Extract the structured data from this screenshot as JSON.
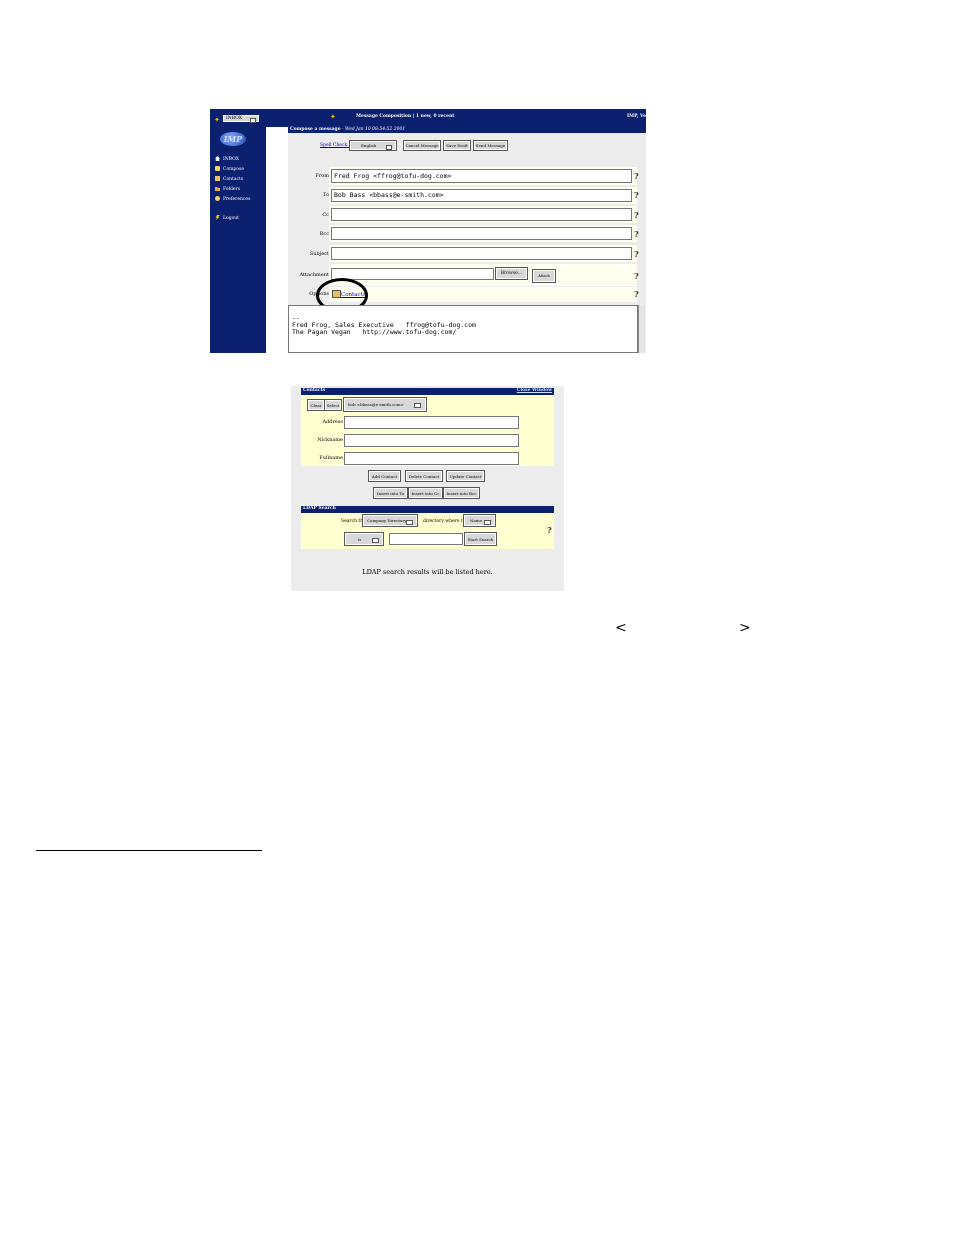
{
  "mail": {
    "topbar": {
      "folder_select": "INBOX",
      "title": "Message Composition | 1 new, 0 recent",
      "right_text": "IMP, Ve"
    },
    "sidebar": {
      "logo_text": "IMP",
      "items": [
        {
          "label": "INBOX",
          "icon": "house-icon"
        },
        {
          "label": "Compose",
          "icon": "compose-icon"
        },
        {
          "label": "Contacts",
          "icon": "contacts-icon"
        },
        {
          "label": "Folders",
          "icon": "folder-icon"
        },
        {
          "label": "Preferences",
          "icon": "preferences-icon"
        },
        {
          "label": "Logout",
          "icon": "logout-icon"
        }
      ]
    },
    "header": {
      "title": "Compose a message",
      "date": " - Wed Jan 10 08:54:52 2001"
    },
    "toolbar": {
      "spellcheck_link": "Spell Check in:",
      "language": "English",
      "cancel": "Cancel Message",
      "save_draft": "Save Draft",
      "send": "Send Message"
    },
    "fields": {
      "from_label": "From",
      "from_value": "Fred Frog <ffrog@tofu-dog.com>",
      "to_label": "To",
      "to_value": "Bob Bass <bbass@e-smith.com>",
      "cc_label": "Cc",
      "bcc_label": "Bcc",
      "subject_label": "Subject",
      "attachment_label": "Attachment",
      "browse": "Browse...",
      "attach": "Attach",
      "options_label": "Options",
      "contacts_link": "Contacts"
    },
    "help_glyph": "?",
    "body_text": "\n--\nFred Frog, Sales Executive   ffrog@tofu-dog.com\nThe Pagan Vegan   http://www.tofu-dog.com/"
  },
  "contacts": {
    "title": "Contacts",
    "close": "Close Window",
    "clear": "Clear",
    "select": "Select",
    "selected": "bob <bbass@e-smith.com>",
    "address_label": "Address",
    "nickname_label": "Nickname",
    "fullname_label": "Fullname",
    "add": "Add Contact",
    "delete": "Delete Contact",
    "update": "Update Contact",
    "insert_to": "Insert into To",
    "insert_cc": "Insert into Cc",
    "insert_bcc": "Insert into Bcc",
    "ldap_title": "LDAP Search",
    "search_the": "Search the",
    "directory": "Company Directory",
    "where_the": "directory where the",
    "field": "Name",
    "op": "is",
    "start_search": "Start Search",
    "results": "LDAP search results will be listed here."
  },
  "page": {
    "lt": "<",
    "gt": ">"
  }
}
